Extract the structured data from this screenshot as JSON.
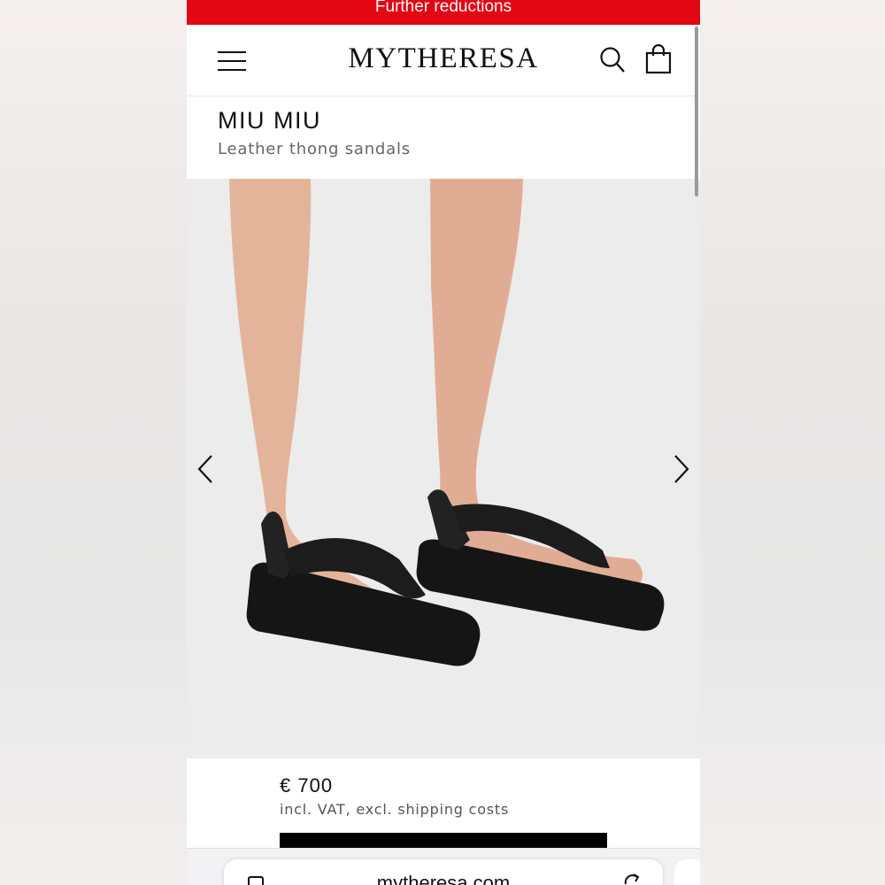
{
  "promo": {
    "text": "Further reductions"
  },
  "header": {
    "logo": "MYTHERESA"
  },
  "product": {
    "brand": "MIU MIU",
    "name": "Leather thong sandals",
    "price": "€ 700",
    "vat_note": "incl. VAT, excl. shipping costs"
  },
  "browser": {
    "url": "mytheresa.com"
  },
  "icons": [
    "menu-icon",
    "search-icon",
    "shopping-bag-icon",
    "chevron-left-icon",
    "chevron-right-icon",
    "tabs-icon",
    "reload-icon"
  ],
  "colors": {
    "promo_red": "#e30613",
    "text_dark": "#111111",
    "text_grey": "#666666",
    "cta_black": "#000000"
  }
}
